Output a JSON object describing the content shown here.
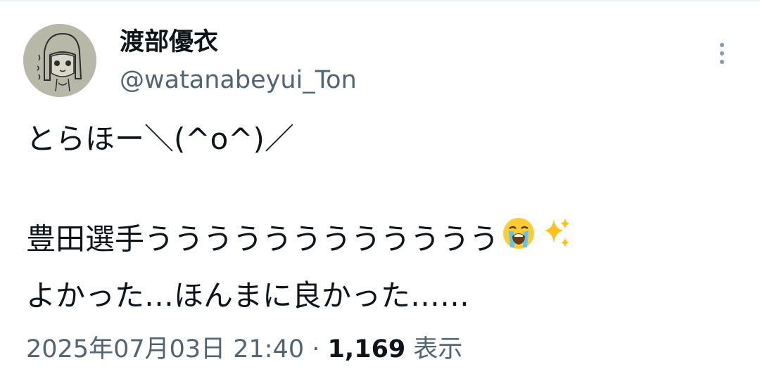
{
  "author": {
    "display_name": "渡部優衣",
    "handle": "@watanabeyui_Ton"
  },
  "tweet": {
    "line1": "とらほー＼(^o^)／",
    "line2": "豊田選手うううううううううううう",
    "line3": "よかった…ほんまに良かった……"
  },
  "emojis": [
    "loudly-crying-face-icon",
    "sparkles-icon"
  ],
  "meta": {
    "timestamp": "2025年07月03日 21:40",
    "separator": "·",
    "views_count": "1,169",
    "views_label": "表示"
  },
  "colors": {
    "text": "#0f1419",
    "secondary": "#536471",
    "more_icon": "#8b98a5"
  }
}
